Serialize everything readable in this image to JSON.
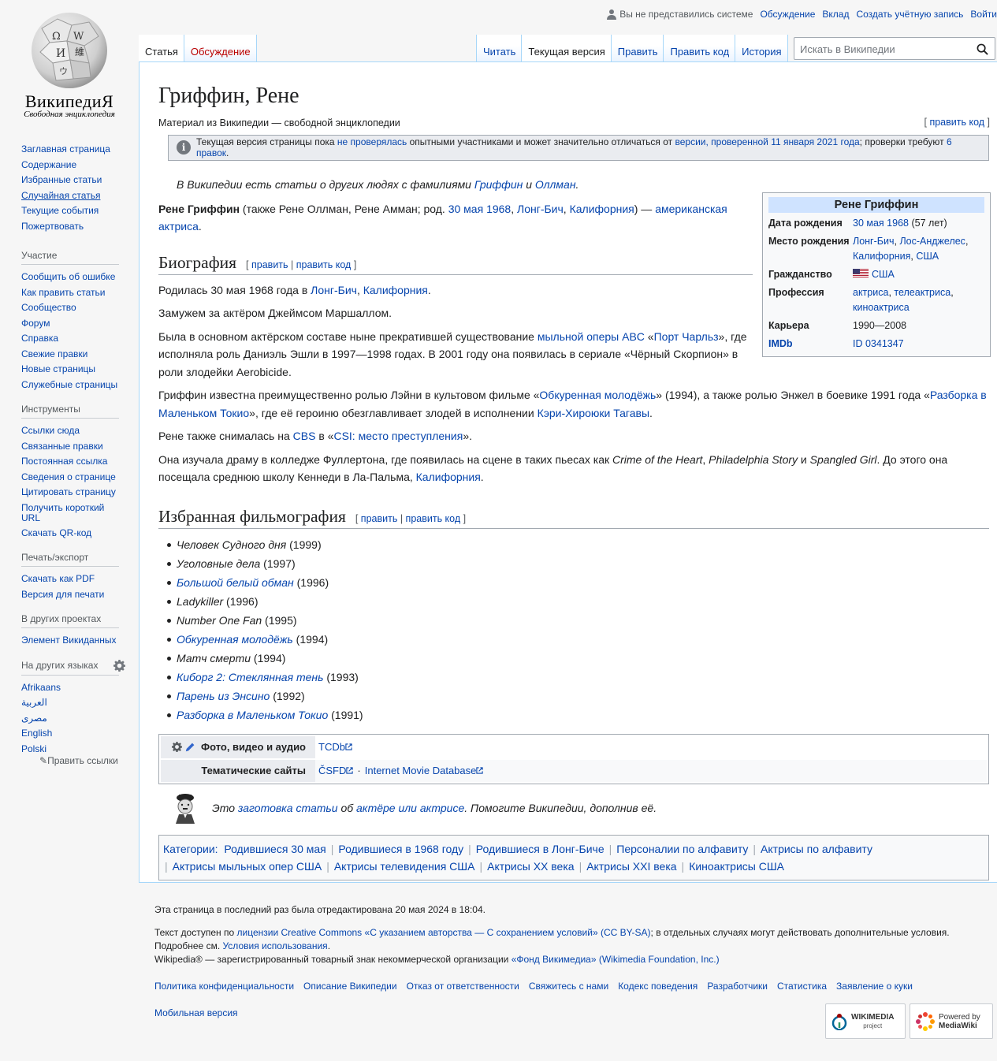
{
  "personal": {
    "not_logged_in": "Вы не представились системе",
    "talk": "Обсуждение",
    "contributions": "Вклад",
    "create_account": "Создать учётную запись",
    "login": "Войти"
  },
  "logo": {
    "wordmark": "ВикипедиЯ",
    "tagline": "Свободная энциклопедия"
  },
  "tabs": {
    "article": "Статья",
    "discussion": "Обсуждение",
    "read": "Читать",
    "current": "Текущая версия",
    "edit": "Править",
    "edit_source": "Править код",
    "history": "История"
  },
  "search": {
    "placeholder": "Искать в Википедии"
  },
  "sidebar": {
    "nav": [
      "Заглавная страница",
      "Содержание",
      "Избранные статьи",
      "Случайная статья",
      "Текущие события",
      "Пожертвовать"
    ],
    "participation_title": "Участие",
    "participation": [
      "Сообщить об ошибке",
      "Как править статьи",
      "Сообщество",
      "Форум",
      "Справка",
      "Свежие правки",
      "Новые страницы",
      "Служебные страницы"
    ],
    "tools_title": "Инструменты",
    "tools": [
      "Ссылки сюда",
      "Связанные правки",
      "Постоянная ссылка",
      "Сведения о странице",
      "Цитировать страницу",
      "Получить короткий URL",
      "Скачать QR-код"
    ],
    "print_title": "Печать/экспорт",
    "print": [
      "Скачать как PDF",
      "Версия для печати"
    ],
    "projects_title": "В других проектах",
    "projects": [
      "Элемент Викиданных"
    ],
    "languages_title": "На других языках",
    "languages": [
      "Afrikaans",
      "العربية",
      "مصرى",
      "English",
      "Polski"
    ],
    "edit_links": "Править ссылки"
  },
  "article": {
    "title": "Гриффин, Рене",
    "site_sub": "Материал из Википедии — свободной энциклопедии",
    "edit_code": "править код",
    "flagged": {
      "t1": "Текущая версия страницы пока ",
      "l1": "не проверялась",
      "t2": " опытными участниками и может значительно отличаться от ",
      "l2": "версии, проверенной 11 января 2021 года",
      "t3": "; проверки требуют ",
      "l3": "6 правок",
      "t4": "."
    },
    "hatnote": {
      "t1": "В Википедии есть статьи о других людях с фамилиями ",
      "l1": "Гриффин",
      "t2": " и ",
      "l2": "Оллман",
      "t3": "."
    },
    "lead": {
      "name": "Рене Гриффин",
      "t1": " (также Рене Оллман, Рене Амман; род. ",
      "l1": "30 мая",
      "l2": "1968",
      "l3": "Лонг-Бич",
      "l4": "Калифорния",
      "t2": ") — ",
      "l5": "американская актриса",
      "t3": "."
    },
    "bio_heading": "Биография",
    "edit": "править",
    "bio": {
      "p1_t1": "Родилась 30 мая 1968 года в ",
      "p1_l1": "Лонг-Бич",
      "p1_l2": "Калифорния",
      "p2": "Замужем за актёром Джеймсом Маршаллом.",
      "p3_t1": "Была в основном актёрском составе ныне прекратившей существование ",
      "p3_l1": "мыльной оперы ABC",
      "p3_l2": "Порт Чарльз",
      "p3_t2": "», где исполняла роль Даниэль Эшли в 1997—1998 годах. В 2001 году она появилась в сериале «Чёрный Скорпион» в роли злодейки Aerobicide.",
      "p4_t1": "Гриффин известна преимущественно ролью Лэйни в культовом фильме «",
      "p4_l1": "Обкуренная молодёжь",
      "p4_t2": "» (1994), а также ролью Энжел в боевике 1991 года «",
      "p4_l2": "Разборка в Маленьком Токио",
      "p4_t3": "», где её героиню обезглавливает злодей в исполнении ",
      "p4_l3": "Кэри-Хироюки Тагавы",
      "p5_t1": "Рене также снималась на ",
      "p5_l1": "CBS",
      "p5_t2": " в «",
      "p5_l2": "CSI: место преступления",
      "p5_t3": "».",
      "p6_t1": "Она изучала драму в колледже Фуллертона, где появилась на сцене в таких пьесах как ",
      "p6_i1": "Crime of the Heart",
      "p6_i2": "Philadelphia Story",
      "p6_t2": " и ",
      "p6_i3": "Spangled Girl",
      "p6_t3": ". До этого она посещала среднюю школу Кеннеди в Ла-Пальма, ",
      "p6_l1": "Калифорния"
    },
    "film_heading": "Избранная фильмография",
    "films": [
      {
        "title": "Человек Судного дня",
        "year": " (1999)",
        "link": false
      },
      {
        "title": "Уголовные дела",
        "year": " (1997)",
        "link": false
      },
      {
        "title": "Большой белый обман",
        "year": " (1996)",
        "link": true
      },
      {
        "title": "Ladykiller",
        "year": " (1996)",
        "link": false
      },
      {
        "title": "Number One Fan",
        "year": " (1995)",
        "link": false
      },
      {
        "title": "Обкуренная молодёжь",
        "year": " (1994)",
        "link": true
      },
      {
        "title": "Матч смерти",
        "year": " (1994)",
        "link": false
      },
      {
        "title": "Киборг 2: Стеклянная тень",
        "year": " (1993)",
        "link": true
      },
      {
        "title": "Парень из Энсино",
        "year": " (1992)",
        "link": true
      },
      {
        "title": "Разборка в Маленьком Токио",
        "year": " (1991)",
        "link": true
      }
    ],
    "navbox": {
      "row1_label": "Фото, видео и аудио",
      "row1_link": "TCDb",
      "row2_label": "Тематические сайты",
      "row2_link1": "ČSFD",
      "row2_sep": "·",
      "row2_link2": "Internet Movie Database"
    },
    "stub": {
      "t1": "Это ",
      "l1": "заготовка статьи",
      "t2": " об ",
      "l2": "актёре или актрисе",
      "t3": ". Помогите Википедии, дополнив её."
    },
    "categories_label": "Категории:",
    "categories": [
      "Родившиеся 30 мая",
      "Родившиеся в 1968 году",
      "Родившиеся в Лонг-Биче",
      "Персоналии по алфавиту",
      "Актрисы по алфавиту",
      "Актрисы мыльных опер США",
      "Актрисы телевидения США",
      "Актрисы XX века",
      "Актрисы XXI века",
      "Киноактрисы США"
    ]
  },
  "infobox": {
    "title": "Рене Гриффин",
    "birth_date_label": "Дата рождения",
    "birth_date_link": "30 мая 1968",
    "birth_age": " (57 лет)",
    "birth_place_label": "Место рождения",
    "birth_place_l1": "Лонг-Бич",
    "birth_place_l2": "Лос-Анджелес",
    "birth_place_l3": "Калифорния",
    "birth_place_l4": "США",
    "citizenship_label": "Гражданство",
    "citizenship": "США",
    "profession_label": "Профессия",
    "profession_l1": "актриса",
    "profession_l2": "телеактриса",
    "profession_l3": "киноактриса",
    "career_label": "Карьера",
    "career": "1990—2008",
    "imdb_label": "IMDb",
    "imdb": "ID 0341347"
  },
  "footer": {
    "last_edit": "Эта страница в последний раз была отредактирована 20 мая 2024 в 18:04.",
    "lic_t1": "Текст доступен по ",
    "lic_l1": "лицензии Creative Commons «С указанием авторства — С сохранением условий» (CC BY-SA)",
    "lic_t2": "; в отдельных случаях могут действовать дополнительные условия.",
    "lic_t3": "Подробнее см. ",
    "lic_l2": "Условия использования",
    "lic_t4": ".",
    "tm_t1": "Wikipedia® — зарегистрированный товарный знак некоммерческой организации ",
    "tm_l1": "«Фонд Викимедиа» (Wikimedia Foundation, Inc.)",
    "places": [
      "Политика конфиденциальности",
      "Описание Википедии",
      "Отказ от ответственности",
      "Свяжитесь с нами",
      "Кодекс поведения",
      "Разработчики",
      "Статистика",
      "Заявление о куки"
    ],
    "mobile": "Мобильная версия",
    "wm_badge_l1": "WIKIMEDIA",
    "wm_badge_l2": "project",
    "mw_badge_l1": "Powered by",
    "mw_badge_l2": "MediaWiki"
  },
  "colors": {
    "link": "#0645ad",
    "new_link": "#ba0000",
    "infobox_header": "#cfe3ff",
    "border": "#a7d7f9"
  }
}
